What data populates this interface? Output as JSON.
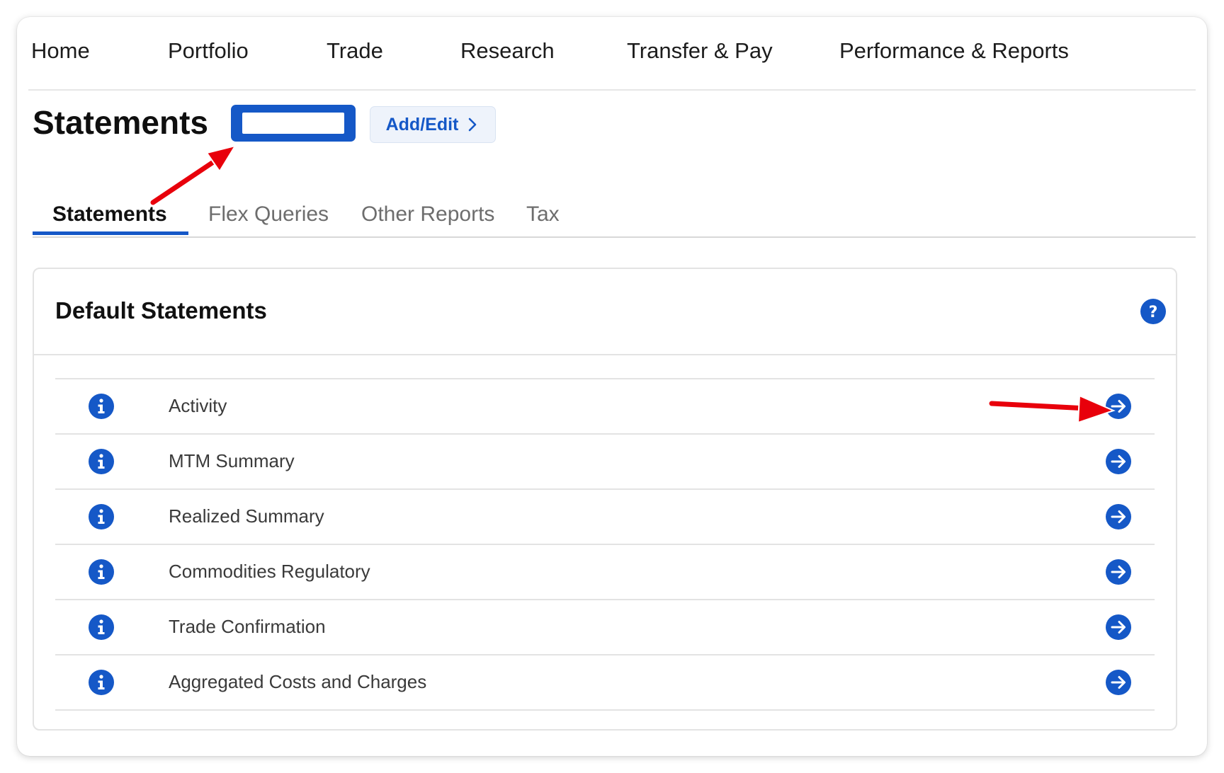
{
  "nav": {
    "items": [
      "Home",
      "Portfolio",
      "Trade",
      "Research",
      "Transfer & Pay",
      "Performance & Reports"
    ]
  },
  "header": {
    "title": "Statements",
    "account_selector_value": "",
    "add_edit_label": "Add/Edit"
  },
  "tabs": [
    {
      "label": "Statements",
      "active": true
    },
    {
      "label": "Flex Queries",
      "active": false
    },
    {
      "label": "Other Reports",
      "active": false
    },
    {
      "label": "Tax",
      "active": false
    }
  ],
  "panel": {
    "title": "Default Statements",
    "rows": [
      {
        "label": "Activity"
      },
      {
        "label": "MTM Summary"
      },
      {
        "label": "Realized Summary"
      },
      {
        "label": "Commodities Regulatory"
      },
      {
        "label": "Trade Confirmation"
      },
      {
        "label": "Aggregated Costs and Charges"
      }
    ]
  },
  "icons": {
    "help": "question-circle-icon",
    "info": "info-circle-icon",
    "go": "arrow-right-circle-icon",
    "chevron": "chevron-right-icon"
  },
  "colors": {
    "accent": "#1558c7",
    "annotation": "#e8000b"
  }
}
